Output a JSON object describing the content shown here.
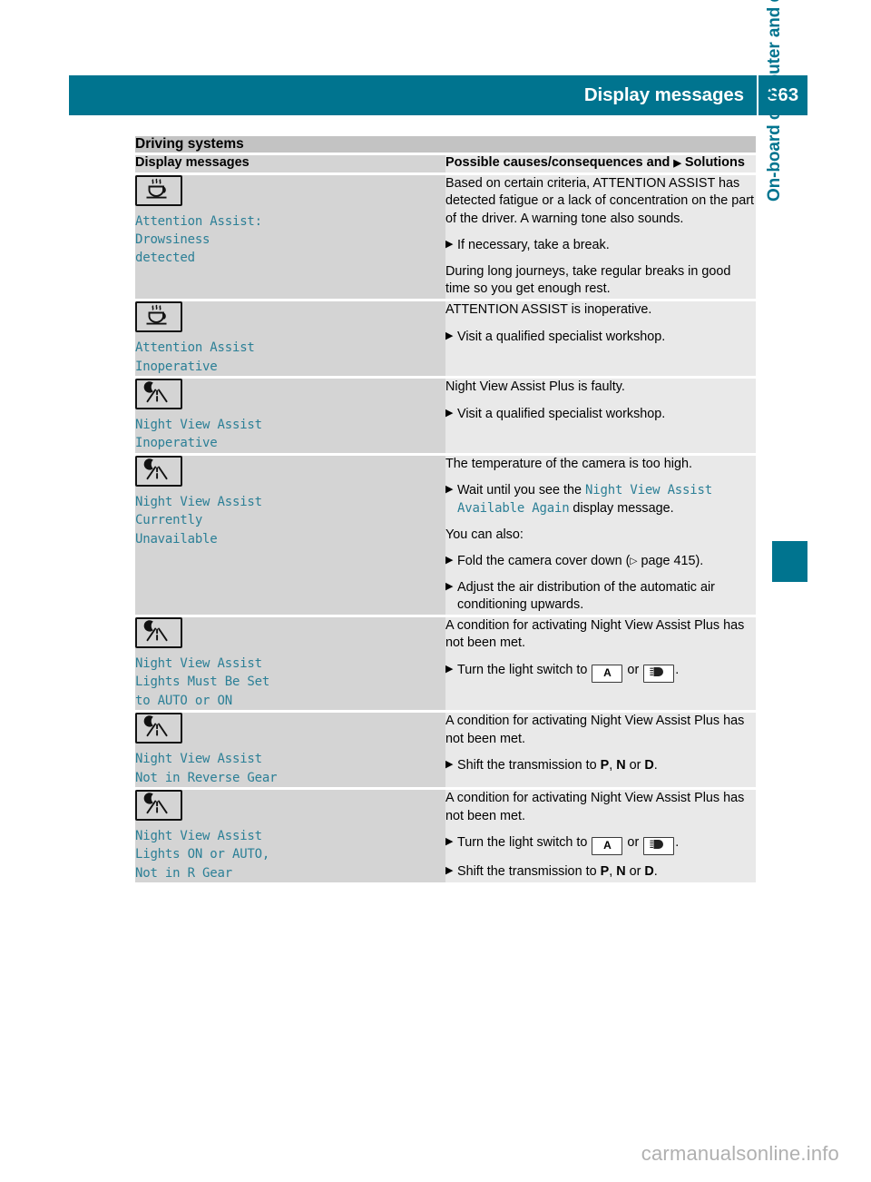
{
  "header": {
    "title": "Display messages",
    "page_number": "363",
    "bar_color": "#00748f"
  },
  "side_tab": {
    "label": "On-board computer and displays",
    "color": "#00748f"
  },
  "table": {
    "section_title": "Driving systems",
    "columns": {
      "left": "Display messages",
      "right_prefix": "Possible causes/consequences and",
      "right_suffix": "Solutions"
    },
    "rows": [
      {
        "icon": "coffee-cup-icon",
        "message": "Attention Assist:\nDrowsiness\ndetected",
        "blocks": [
          {
            "kind": "paragraph",
            "text": "Based on certain criteria, ATTENTION ASSIST has detected fatigue or a lack of concentration on the part of the driver. A warning tone also sounds."
          },
          {
            "kind": "step",
            "text": "If necessary, take a break."
          },
          {
            "kind": "paragraph",
            "text": "During long journeys, take regular breaks in good time so you get enough rest."
          }
        ]
      },
      {
        "icon": "coffee-cup-icon",
        "message": "Attention Assist\nInoperative",
        "blocks": [
          {
            "kind": "paragraph",
            "text": "ATTENTION ASSIST is inoperative."
          },
          {
            "kind": "step",
            "text": "Visit a qualified specialist workshop."
          }
        ]
      },
      {
        "icon": "night-view-assist-icon",
        "message": "Night View Assist\nInoperative",
        "blocks": [
          {
            "kind": "paragraph",
            "text": "Night View Assist Plus is faulty."
          },
          {
            "kind": "step",
            "text": "Visit a qualified specialist workshop."
          }
        ]
      },
      {
        "icon": "night-view-assist-icon",
        "message": "Night View Assist\nCurrently\nUnavailable",
        "blocks": [
          {
            "kind": "paragraph",
            "text": "The temperature of the camera is too high."
          },
          {
            "kind": "step-mono",
            "pre": "Wait until you see the ",
            "mono": "Night View Assist Available Again",
            "post": " display message."
          },
          {
            "kind": "paragraph",
            "text": "You can also:"
          },
          {
            "kind": "step-ref",
            "pre": "Fold the camera cover down (",
            "ref": " page 415",
            "post": ")."
          },
          {
            "kind": "step",
            "text": "Adjust the air distribution of the automatic air conditioning upwards."
          }
        ]
      },
      {
        "icon": "night-view-assist-icon",
        "message": "Night View Assist\nLights Must Be Set\nto AUTO or ON",
        "blocks": [
          {
            "kind": "paragraph",
            "text": "A condition for activating Night View Assist Plus has not been met."
          },
          {
            "kind": "step-lights",
            "pre": "Turn the light switch to ",
            "key_auto": "A",
            "joiner": " or ",
            "key_lights": "headlight-icon",
            "post": "."
          }
        ]
      },
      {
        "icon": "night-view-assist-icon",
        "message": "Night View Assist\nNot in Reverse Gear",
        "blocks": [
          {
            "kind": "paragraph",
            "text": "A condition for activating Night View Assist Plus has not been met."
          },
          {
            "kind": "step-gears",
            "pre": "Shift the transmission to ",
            "g1": "P",
            "sep1": ", ",
            "g2": "N",
            "sep2": " or ",
            "g3": "D",
            "post": "."
          }
        ]
      },
      {
        "icon": "night-view-assist-icon",
        "message": "Night View Assist\nLights ON or AUTO,\nNot in R Gear",
        "blocks": [
          {
            "kind": "paragraph",
            "text": "A condition for activating Night View Assist Plus has not been met."
          },
          {
            "kind": "step-lights",
            "pre": "Turn the light switch to ",
            "key_auto": "A",
            "joiner": " or ",
            "key_lights": "headlight-icon",
            "post": "."
          },
          {
            "kind": "step-gears",
            "pre": "Shift the transmission to ",
            "g1": "P",
            "sep1": ", ",
            "g2": "N",
            "sep2": " or ",
            "g3": "D",
            "post": "."
          }
        ]
      }
    ]
  },
  "watermark": "carmanualsonline.info"
}
